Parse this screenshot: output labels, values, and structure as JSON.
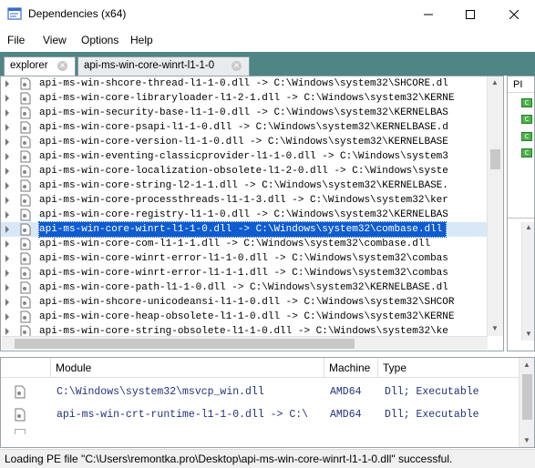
{
  "window": {
    "title": "Dependencies (x64)"
  },
  "menu": {
    "items": [
      "File",
      "View",
      "Options",
      "Help"
    ]
  },
  "tabs": [
    {
      "label": "explorer",
      "active": true
    },
    {
      "label": "api-ms-win-core-winrt-l1-1-0",
      "active": false
    }
  ],
  "tree": {
    "rows": [
      {
        "text": "api-ms-win-shcore-thread-l1-1-0.dll -> C:\\Windows\\system32\\SHCORE.dl",
        "selected": false
      },
      {
        "text": "api-ms-win-core-libraryloader-l1-2-1.dll -> C:\\Windows\\system32\\KERNE",
        "selected": false
      },
      {
        "text": "api-ms-win-security-base-l1-1-0.dll -> C:\\Windows\\system32\\KERNELBAS",
        "selected": false
      },
      {
        "text": "api-ms-win-core-psapi-l1-1-0.dll -> C:\\Windows\\system32\\KERNELBASE.d",
        "selected": false
      },
      {
        "text": "api-ms-win-core-version-l1-1-0.dll -> C:\\Windows\\system32\\KERNELBASE",
        "selected": false
      },
      {
        "text": "api-ms-win-eventing-classicprovider-l1-1-0.dll -> C:\\Windows\\system3",
        "selected": false
      },
      {
        "text": "api-ms-win-core-localization-obsolete-l1-2-0.dll -> C:\\Windows\\syste",
        "selected": false
      },
      {
        "text": "api-ms-win-core-string-l2-1-1.dll -> C:\\Windows\\system32\\KERNELBASE.",
        "selected": false
      },
      {
        "text": "api-ms-win-core-processthreads-l1-1-3.dll -> C:\\Windows\\system32\\ker",
        "selected": false
      },
      {
        "text": "api-ms-win-core-registry-l1-1-0.dll -> C:\\Windows\\system32\\KERNELBAS",
        "selected": false
      },
      {
        "text": "api-ms-win-core-winrt-l1-1-0.dll -> C:\\Windows\\system32\\combase.dll",
        "selected": true
      },
      {
        "text": "api-ms-win-core-com-l1-1-1.dll -> C:\\Windows\\system32\\combase.dll",
        "selected": false
      },
      {
        "text": "api-ms-win-core-winrt-error-l1-1-0.dll -> C:\\Windows\\system32\\combas",
        "selected": false
      },
      {
        "text": "api-ms-win-core-winrt-error-l1-1-1.dll -> C:\\Windows\\system32\\combas",
        "selected": false
      },
      {
        "text": "api-ms-win-core-path-l1-1-0.dll -> C:\\Windows\\system32\\KERNELBASE.dl",
        "selected": false
      },
      {
        "text": "api-ms-win-shcore-unicodeansi-l1-1-0.dll -> C:\\Windows\\system32\\SHCOR",
        "selected": false
      },
      {
        "text": "api-ms-win-core-heap-obsolete-l1-1-0.dll -> C:\\Windows\\system32\\KERNE",
        "selected": false
      },
      {
        "text": "api-ms-win-core-string-obsolete-l1-1-0.dll -> C:\\Windows\\system32\\ke",
        "selected": false
      }
    ]
  },
  "right_panel": {
    "header": "PI",
    "icon_glyph": "C"
  },
  "modules": {
    "columns": [
      "Module",
      "Machine",
      "Type"
    ],
    "rows": [
      {
        "module": "C:\\Windows\\system32\\msvcp_win.dll",
        "machine": "AMD64",
        "type": "Dll; Executable"
      },
      {
        "module": "api-ms-win-crt-runtime-l1-1-0.dll -> C:\\",
        "machine": "AMD64",
        "type": "Dll; Executable"
      }
    ]
  },
  "status": {
    "text": "Loading PE file \"C:\\Users\\remontka.pro\\Desktop\\api-ms-win-core-winrt-l1-1-0.dll\" successful."
  },
  "colors": {
    "tab_bar": "#4f8584",
    "selection": "#0f5ccf",
    "module_text": "#23327a"
  }
}
